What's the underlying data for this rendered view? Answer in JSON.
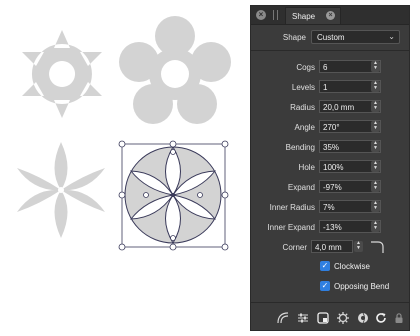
{
  "panel": {
    "tab_label": "Shape",
    "shape_label": "Shape",
    "shape_value": "Custom",
    "properties": [
      {
        "label": "Cogs",
        "value": "6"
      },
      {
        "label": "Levels",
        "value": "1"
      },
      {
        "label": "Radius",
        "value": "20,0 mm"
      },
      {
        "label": "Angle",
        "value": "270°"
      },
      {
        "label": "Bending",
        "value": "35%"
      },
      {
        "label": "Hole",
        "value": "100%"
      },
      {
        "label": "Expand",
        "value": "-97%"
      },
      {
        "label": "Inner Radius",
        "value": "7%"
      },
      {
        "label": "Inner Expand",
        "value": "-13%"
      }
    ],
    "corner_label": "Corner",
    "corner_value": "4,0 mm",
    "clockwise_label": "Clockwise",
    "clockwise_checked": true,
    "opposing_bend_label": "Opposing Bend",
    "opposing_bend_checked": true,
    "toolbar_icons": [
      "curve-icon",
      "sliders-icon",
      "square-icon",
      "cog-shape-icon",
      "flower-icon",
      "refresh-icon",
      "lock-icon"
    ]
  },
  "canvas": {
    "shapes": [
      "cog-shape",
      "flower-shape",
      "star-flower-shape",
      "selected-flower-shape"
    ],
    "shape_fill": "#d3d3d3",
    "selection_color": "#3a3a5a"
  },
  "colors": {
    "panel_bg": "#3b3b3b",
    "field_bg": "#2b2b2b",
    "accent": "#2f7fe0"
  }
}
